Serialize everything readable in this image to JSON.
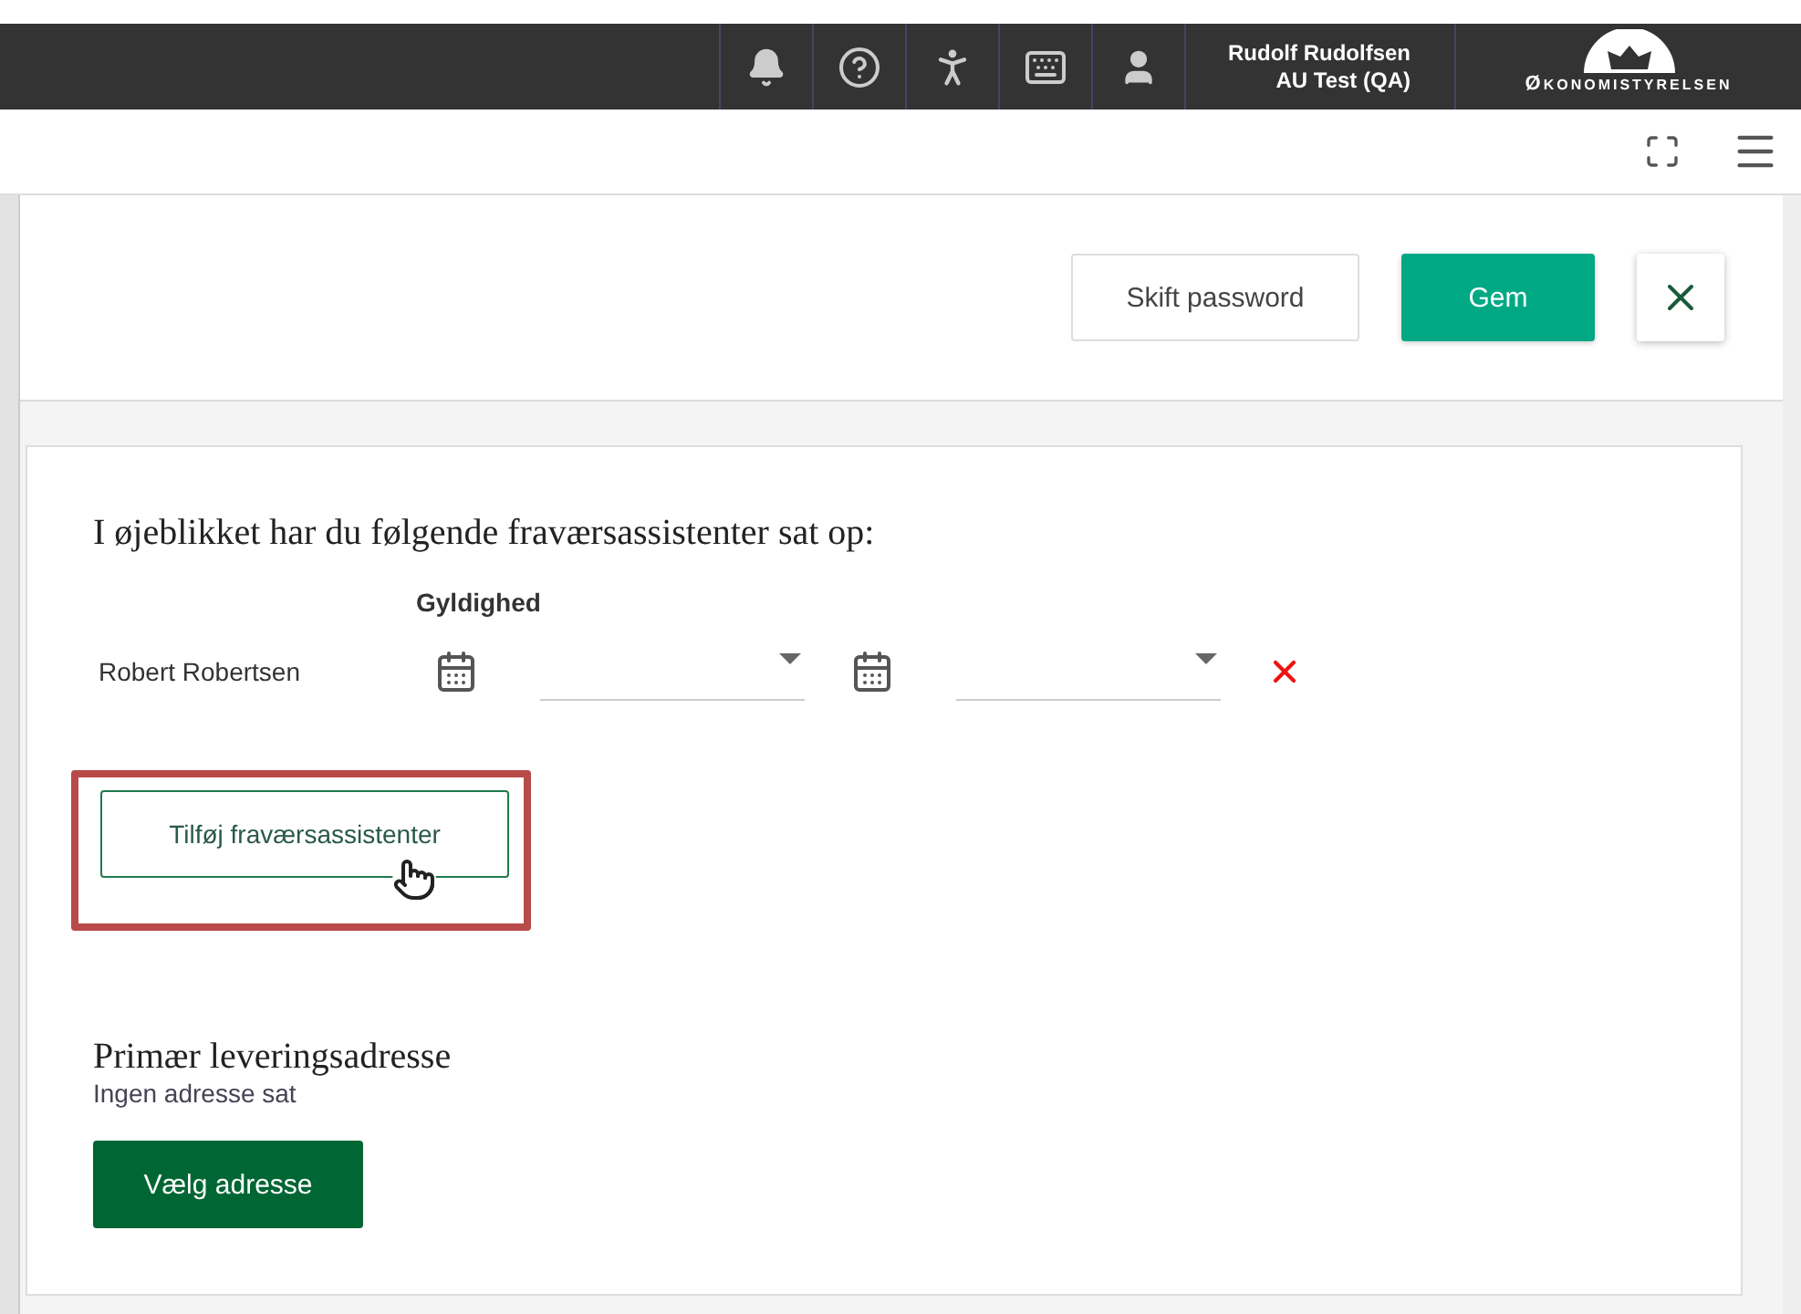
{
  "top_bar": {
    "user_name": "Rudolf Rudolfsen",
    "user_role": "AU Test (QA)",
    "logo_text": "Økonomistyrelsen"
  },
  "actions": {
    "secondary": "Skift password",
    "primary": "Gem"
  },
  "assistants": {
    "intro": "I øjeblikket har du følgende fraværsassistenter sat op:",
    "column_heading": "Gyldighed",
    "rows": [
      {
        "name": "Robert Robertsen"
      }
    ],
    "add_button": "Tilføj fraværsassistenter"
  },
  "address": {
    "heading": "Primær leveringsadresse",
    "status": "Ingen adresse sat",
    "button": "Vælg adresse"
  }
}
